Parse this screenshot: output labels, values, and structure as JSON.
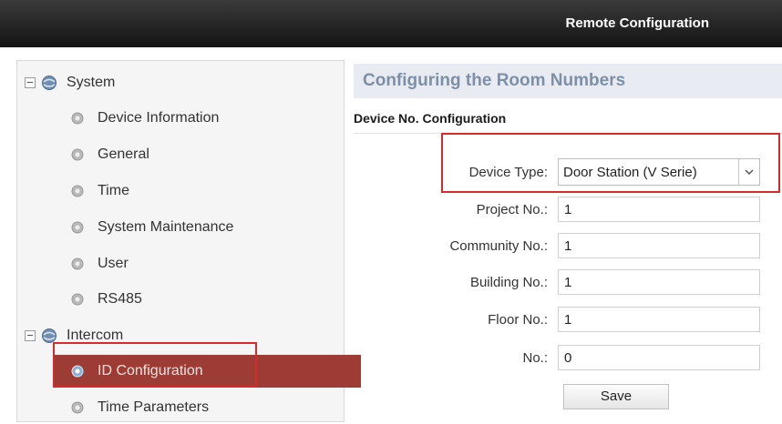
{
  "window": {
    "title": "Remote Configuration"
  },
  "sidebar": {
    "groups": [
      {
        "label": "System",
        "items": [
          "Device Information",
          "General",
          "Time",
          "System Maintenance",
          "User",
          "RS485"
        ]
      },
      {
        "label": "Intercom",
        "items": [
          "ID Configuration",
          "Time Parameters"
        ]
      }
    ],
    "selected_item": "ID Configuration"
  },
  "main": {
    "title": "Configuring the Room Numbers",
    "section_title": "Device No. Configuration",
    "device_type": {
      "label": "Device Type:",
      "value": "Door Station (V Serie)"
    },
    "fields": [
      {
        "label": "Project No.:",
        "value": "1"
      },
      {
        "label": "Community No.:",
        "value": "1"
      },
      {
        "label": "Building No.:",
        "value": "1"
      },
      {
        "label": "Floor No.:",
        "value": "1"
      },
      {
        "label": "No.:",
        "value": "0"
      }
    ],
    "save_label": "Save"
  },
  "colors": {
    "selected_bg": "#9c3c34",
    "highlight_border": "#d62b2b",
    "banner_text": "#7e8fa8"
  }
}
